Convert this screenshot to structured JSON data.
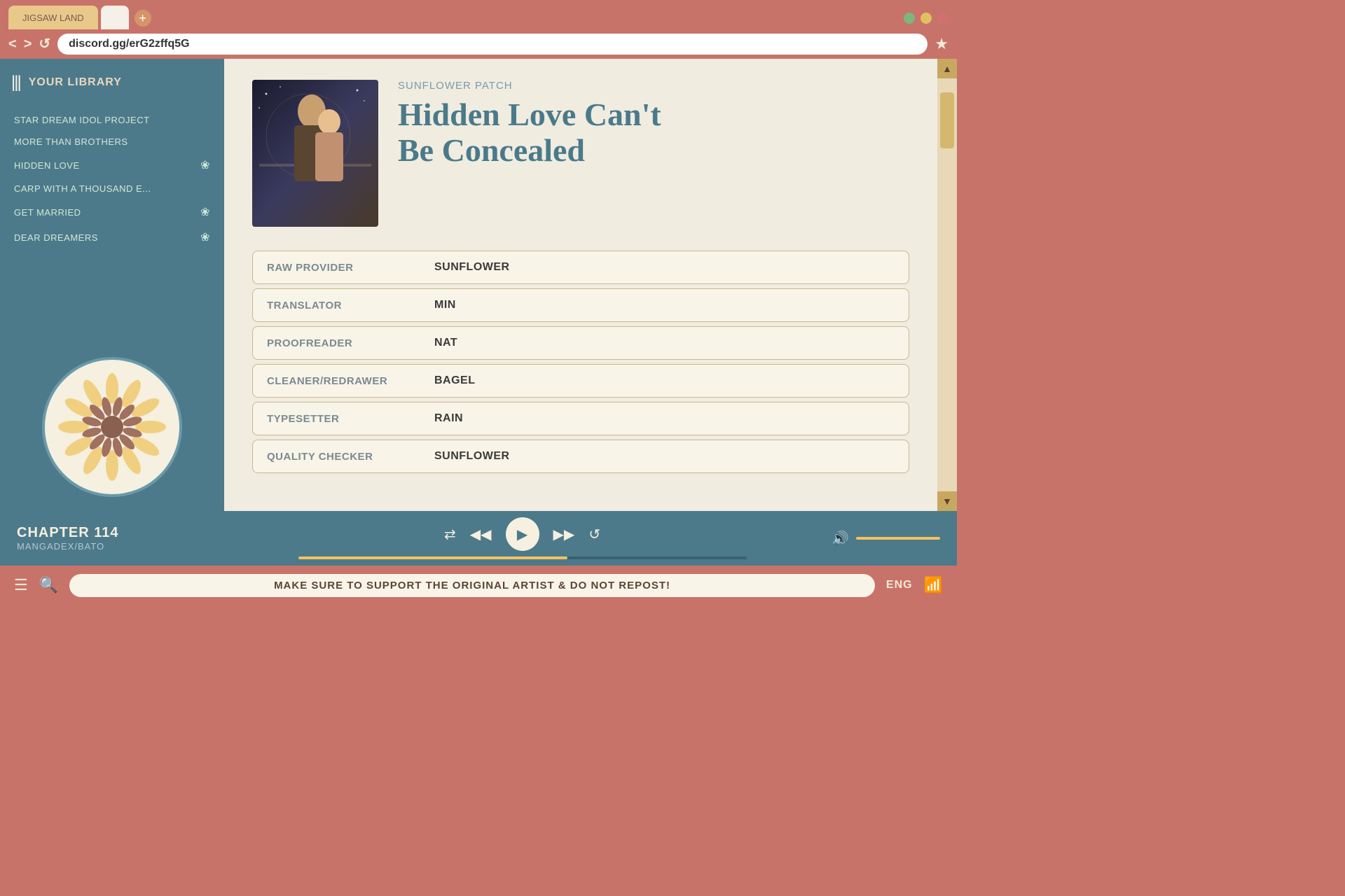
{
  "browser": {
    "tab_inactive_label": "JIGSAW LAND",
    "tab_active_label": "",
    "tab_add_symbol": "+",
    "url": "discord.gg/erG2zffq5G",
    "back_btn": "<",
    "forward_btn": ">",
    "refresh_btn": "↺",
    "star_btn": "★",
    "window_controls": [
      "green",
      "yellow",
      "red"
    ]
  },
  "sidebar": {
    "library_title": "YOUR LIBRARY",
    "items": [
      {
        "label": "STAR DREAM IDOL PROJECT",
        "has_heart": false
      },
      {
        "label": "MORE THAN BROTHERS",
        "has_heart": false
      },
      {
        "label": "HIDDEN LOVE",
        "has_heart": true
      },
      {
        "label": "CARP WITH A THOUSAND E...",
        "has_heart": false
      },
      {
        "label": "GET MARRIED",
        "has_heart": true
      },
      {
        "label": "DEAR DREAMERS",
        "has_heart": true
      }
    ]
  },
  "manga": {
    "group_name": "SUNFLOWER PATCH",
    "title_line1": "Hidden Love Can't",
    "title_line2": "Be Concealed",
    "credits": [
      {
        "role": "RAW PROVIDER",
        "name": "SUNFLOWER"
      },
      {
        "role": "TRANSLATOR",
        "name": "MIN"
      },
      {
        "role": "PROOFREADER",
        "name": "NAT"
      },
      {
        "role": "CLEANER/REDRAWER",
        "name": "BAGEL"
      },
      {
        "role": "TYPESETTER",
        "name": "RAIN"
      },
      {
        "role": "QUALITY CHECKER",
        "name": "SUNFLOWER"
      }
    ]
  },
  "player": {
    "chapter_label": "CHAPTER 114",
    "source_label": "MANGADEX/BATO",
    "shuffle_symbol": "⇄",
    "prev_symbol": "◀◀",
    "play_symbol": "▶",
    "next_symbol": "▶▶",
    "repeat_symbol": "↺",
    "volume_symbol": "🔊",
    "progress_percent": 60
  },
  "status_bar": {
    "menu_symbol": "☰",
    "search_symbol": "🔍",
    "message": "MAKE SURE TO SUPPORT THE ORIGINAL ARTIST & DO NOT REPOST!",
    "language": "ENG",
    "wifi_symbol": "📶"
  },
  "colors": {
    "teal": "#4d7a8a",
    "salmon": "#c8736a",
    "cream": "#f5f0e8",
    "gold": "#f5c060",
    "text_teal": "#4a7a8a"
  }
}
